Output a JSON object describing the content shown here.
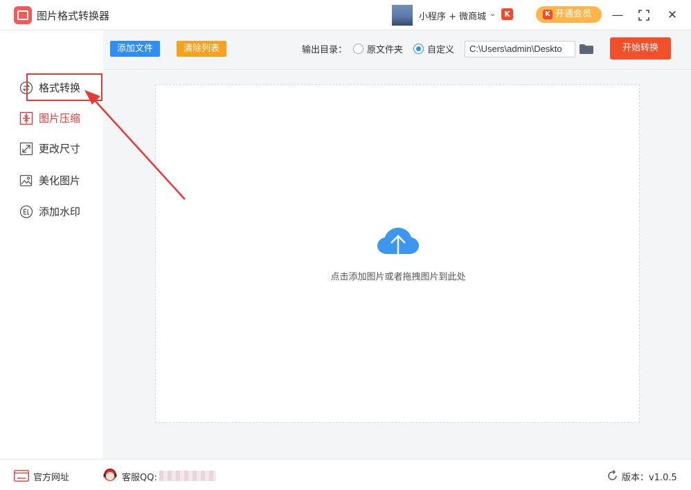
{
  "titlebar": {
    "app_title": "图片格式转换器",
    "mini_program": "小程序 + 微商城",
    "vip_label": "开通会员"
  },
  "toolbar": {
    "add_file": "添加文件",
    "clear_list": "清除列表",
    "output_label": "输出目录：",
    "option_original": "原文件夹",
    "option_custom": "自定义",
    "output_path": "C:\\Users\\admin\\Deskto",
    "start": "开始转换"
  },
  "sidebar": {
    "items": [
      {
        "label": "格式转换"
      },
      {
        "label": "图片压缩"
      },
      {
        "label": "更改尺寸"
      },
      {
        "label": "美化图片"
      },
      {
        "label": "添加水印"
      }
    ]
  },
  "main": {
    "drop_hint": "点击添加图片或者拖拽图片到此处"
  },
  "statusbar": {
    "website": "官方网址",
    "qq_label": "客服QQ:",
    "version": "版本：v1.0.5"
  },
  "colors": {
    "accent_blue": "#2f8ef5",
    "accent_orange": "#f7a21f",
    "start_red": "#f1502a",
    "active_red": "#e03a3a",
    "annotation_red": "#e53935"
  }
}
